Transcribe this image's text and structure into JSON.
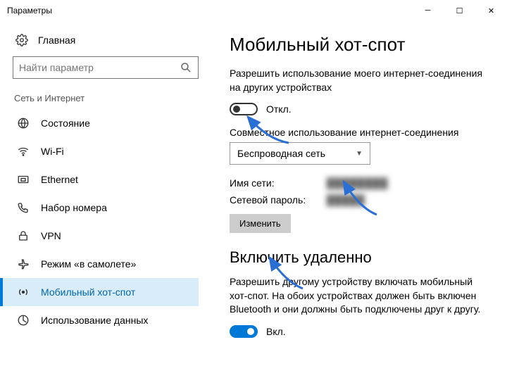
{
  "window": {
    "title": "Параметры"
  },
  "sidebar": {
    "home": "Главная",
    "search_placeholder": "Найти параметр",
    "section": "Сеть и Интернет",
    "items": [
      {
        "label": "Состояние",
        "icon": "status"
      },
      {
        "label": "Wi-Fi",
        "icon": "wifi"
      },
      {
        "label": "Ethernet",
        "icon": "ethernet"
      },
      {
        "label": "Набор номера",
        "icon": "dialup"
      },
      {
        "label": "VPN",
        "icon": "vpn"
      },
      {
        "label": "Режим «в самолете»",
        "icon": "airplane"
      },
      {
        "label": "Мобильный хот-спот",
        "icon": "hotspot",
        "selected": true
      },
      {
        "label": "Использование данных",
        "icon": "data"
      }
    ]
  },
  "main": {
    "title": "Мобильный хот-спот",
    "share_desc": "Разрешить использование моего интернет-соединения на других устройствах",
    "share_toggle_label": "Откл.",
    "conn_label": "Совместное использование интернет-соединения",
    "conn_value": "Беспроводная сеть",
    "net_name_label": "Имя сети:",
    "net_name_value": "████████",
    "net_pass_label": "Сетевой пароль:",
    "net_pass_value": "█████",
    "change_btn": "Изменить",
    "remote_title": "Включить удаленно",
    "remote_desc": "Разрешить другому устройству включать мобильный хот-спот. На обоих устройствах должен быть включен Bluetooth и они должны быть подключены друг к другу.",
    "remote_toggle_label": "Вкл."
  }
}
